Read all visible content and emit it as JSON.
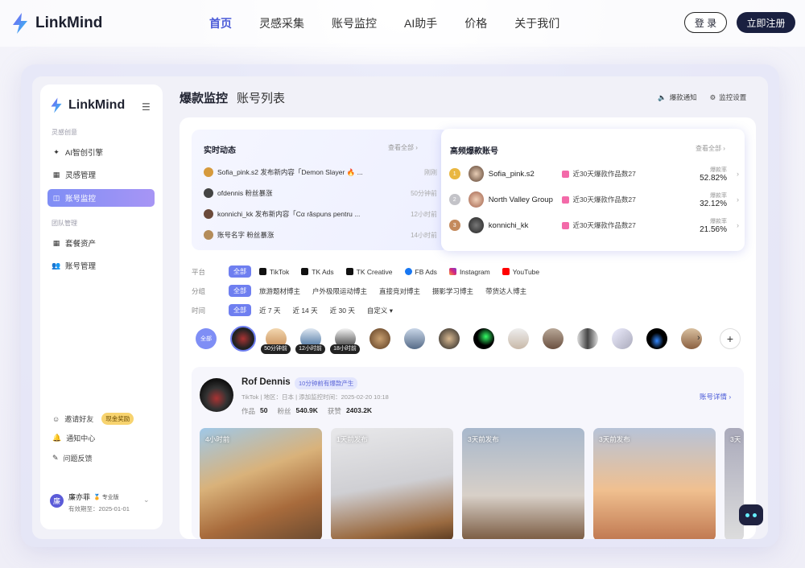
{
  "brand": {
    "name": "LinkMind"
  },
  "topnav": {
    "links": [
      "首页",
      "灵感采集",
      "账号监控",
      "AI助手",
      "价格",
      "关于我们"
    ],
    "login": "登 录",
    "register": "立即注册"
  },
  "sidebar": {
    "brand": "LinkMind",
    "section1": "灵感创意",
    "section2": "团队管理",
    "items": [
      "AI智创引擎",
      "灵感管理",
      "账号监控",
      "套餐资产",
      "账号管理"
    ],
    "invite": "邀请好友",
    "invite_badge": "现金奖励",
    "notify": "通知中心",
    "feedback": "问题反馈",
    "user": {
      "avatar": "廉",
      "name": "廉亦菲",
      "plan": "专业版",
      "expire": "有效期至：2025-01-01"
    }
  },
  "header": {
    "title": "爆款监控",
    "subtitle": "账号列表",
    "notify": "爆款通知",
    "settings": "监控设置"
  },
  "realtime": {
    "title": "实时动态",
    "more": "查看全部 ›",
    "items": [
      {
        "user": "Sofia_pink.s2",
        "text": "发布新内容「Demon Slayer 🔥 ...",
        "time": "刚刚"
      },
      {
        "user": "ofdennis",
        "text": "粉丝暴涨",
        "time": "50分钟前"
      },
      {
        "user": "konnichi_kk",
        "text": "发布新内容「Cα răspuns pentru ...",
        "time": "12小时前"
      },
      {
        "user": "账号名字",
        "text": "粉丝暴涨",
        "time": "14小时前"
      }
    ]
  },
  "hot": {
    "title": "高频爆款账号",
    "more": "查看全部 ›",
    "rate_label": "爆款率",
    "rows": [
      {
        "name": "Sofia_pink.s2",
        "stat": "近30天爆款作品数27",
        "rate": "52.82%"
      },
      {
        "name": "North Valley Group",
        "stat": "近30天爆款作品数27",
        "rate": "32.12%"
      },
      {
        "name": "konnichi_kk",
        "stat": "近30天爆款作品数27",
        "rate": "21.56%"
      }
    ]
  },
  "filters": {
    "platform": {
      "label": "平台",
      "all": "全部",
      "options": [
        "TikTok",
        "TK Ads",
        "TK Creative",
        "FB Ads",
        "Instagram",
        "YouTube"
      ]
    },
    "group": {
      "label": "分组",
      "all": "全部",
      "options": [
        "旅游题材博主",
        "户外极限运动博主",
        "直接竞对博主",
        "摄影学习博主",
        "带货达人博主"
      ]
    },
    "time": {
      "label": "时间",
      "all": "全部",
      "options": [
        "近 7 天",
        "近 14 天",
        "近 30 天",
        "自定义 ▾"
      ]
    }
  },
  "strip": {
    "all": "全部",
    "tags": [
      "50分钟前",
      "12小时前",
      "18小时前"
    ],
    "next": "›",
    "add": "+"
  },
  "account": {
    "name": "Rof Dennis",
    "badge": "10分钟前有爆款产生",
    "meta": "TikTok  |  地区：日本  |  添加监控时间：2025-02-20 10:18",
    "works_label": "作品",
    "works": "50",
    "fans_label": "粉丝",
    "fans": "540.9K",
    "likes_label": "获赞",
    "likes": "2403.2K",
    "detail_link": "账号详情 ›"
  },
  "media": [
    "4小时前",
    "1天前发布",
    "3天前发布",
    "3天前发布",
    "3天"
  ]
}
